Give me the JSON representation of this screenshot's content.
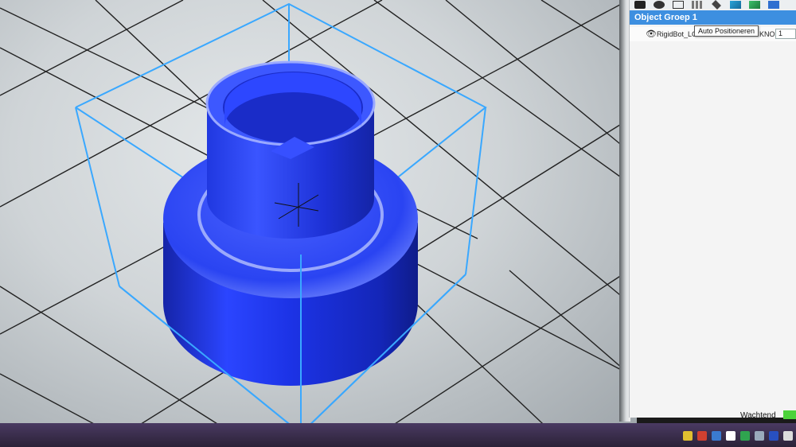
{
  "panel": {
    "group_title": "Object Groep 1",
    "object_name": "RigidBot_LCD",
    "object_suffix": "KNOB",
    "count": "1",
    "tooltip": "Auto Positioneren"
  },
  "status": {
    "text": "Wachtend",
    "color": "#4cd23a"
  },
  "colors": {
    "object": "#1f3cf0",
    "bbox": "#3aa8ff",
    "selection": "#3d8fe0"
  },
  "icons": [
    "trash-icon",
    "info-icon",
    "copy-icon",
    "auto-position-icon",
    "move-icon",
    "scale-icon",
    "mirror-icon"
  ]
}
